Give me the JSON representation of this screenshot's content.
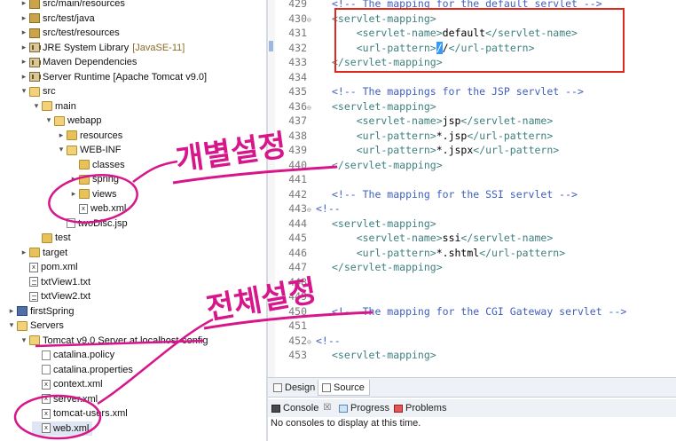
{
  "explorer": {
    "rows": [
      {
        "label": "src/main/resources",
        "indent": 1,
        "twisty": "▸",
        "icon": "pkg",
        "dim": false
      },
      {
        "label": "src/test/java",
        "indent": 1,
        "twisty": "▸",
        "icon": "pkg",
        "dim": false
      },
      {
        "label": "src/test/resources",
        "indent": 1,
        "twisty": "▸",
        "icon": "pkg",
        "dim": false
      },
      {
        "label": "JRE System Library",
        "suffix": "[JavaSE-11]",
        "indent": 1,
        "twisty": "▸",
        "icon": "lib",
        "dim": false
      },
      {
        "label": "Maven Dependencies",
        "indent": 1,
        "twisty": "▸",
        "icon": "lib",
        "dim": false
      },
      {
        "label": "Server Runtime [Apache Tomcat v9.0]",
        "indent": 1,
        "twisty": "▸",
        "icon": "lib",
        "dim": false
      },
      {
        "label": "src",
        "indent": 1,
        "twisty": "▾",
        "icon": "folder-open",
        "dim": false
      },
      {
        "label": "main",
        "indent": 2,
        "twisty": "▾",
        "icon": "folder-open",
        "dim": false
      },
      {
        "label": "webapp",
        "indent": 3,
        "twisty": "▾",
        "icon": "folder-open",
        "dim": false
      },
      {
        "label": "resources",
        "indent": 4,
        "twisty": "▸",
        "icon": "folder",
        "dim": false
      },
      {
        "label": "WEB-INF",
        "indent": 4,
        "twisty": "▾",
        "icon": "folder-open",
        "dim": false
      },
      {
        "label": "classes",
        "indent": 5,
        "twisty": "",
        "icon": "folder",
        "dim": false
      },
      {
        "label": "spring",
        "indent": 5,
        "twisty": "▸",
        "icon": "folder",
        "dim": false
      },
      {
        "label": "views",
        "indent": 5,
        "twisty": "▸",
        "icon": "folder",
        "dim": false
      },
      {
        "label": "web.xml",
        "indent": 5,
        "twisty": "",
        "icon": "xml",
        "dim": false
      },
      {
        "label": "twoDisc.jsp",
        "indent": 4,
        "twisty": "",
        "icon": "jsp",
        "dim": false
      },
      {
        "label": "test",
        "indent": 2,
        "twisty": "",
        "icon": "folder",
        "dim": false
      },
      {
        "label": "target",
        "indent": 1,
        "twisty": "▸",
        "icon": "folder",
        "dim": false
      },
      {
        "label": "pom.xml",
        "indent": 1,
        "twisty": "",
        "icon": "xml",
        "dim": false
      },
      {
        "label": "txtView1.txt",
        "indent": 1,
        "twisty": "",
        "icon": "txt",
        "dim": false
      },
      {
        "label": "txtView2.txt",
        "indent": 1,
        "twisty": "",
        "icon": "txt",
        "dim": false
      },
      {
        "label": "firstSpring",
        "indent": 0,
        "twisty": "▸",
        "icon": "proj",
        "dim": false
      },
      {
        "label": "Servers",
        "indent": 0,
        "twisty": "▾",
        "icon": "folder-open",
        "dim": false
      },
      {
        "label": "Tomcat v9.0 Server at localhost-config",
        "indent": 1,
        "twisty": "▾",
        "icon": "folder-open",
        "dim": false
      },
      {
        "label": "catalina.policy",
        "indent": 2,
        "twisty": "",
        "icon": "file",
        "dim": false
      },
      {
        "label": "catalina.properties",
        "indent": 2,
        "twisty": "",
        "icon": "file",
        "dim": false
      },
      {
        "label": "context.xml",
        "indent": 2,
        "twisty": "",
        "icon": "xml",
        "dim": false
      },
      {
        "label": "server.xml",
        "indent": 2,
        "twisty": "",
        "icon": "xml",
        "dim": false
      },
      {
        "label": "tomcat-users.xml",
        "indent": 2,
        "twisty": "",
        "icon": "xml",
        "dim": false
      },
      {
        "label": "web.xml",
        "indent": 2,
        "twisty": "",
        "icon": "xml",
        "dim": false,
        "selected": true
      }
    ]
  },
  "editor": {
    "lines": [
      {
        "num": "429",
        "fold": "",
        "parts": [
          [
            "cmt",
            "<!-- The mapping for the default servlet -->"
          ]
        ]
      },
      {
        "num": "430",
        "fold": "⊖",
        "parts": [
          [
            "tag",
            "<servlet-mapping>"
          ]
        ]
      },
      {
        "num": "431",
        "fold": "",
        "parts": [
          [
            "sp",
            "    "
          ],
          [
            "tag",
            "<servlet-name>"
          ],
          [
            "txtv",
            "default"
          ],
          [
            "tag",
            "</servlet-name>"
          ]
        ]
      },
      {
        "num": "432",
        "fold": "",
        "parts": [
          [
            "sp",
            "    "
          ],
          [
            "tag",
            "<url-pattern>"
          ],
          [
            "sel",
            "/"
          ],
          [
            "txtv",
            "/"
          ],
          [
            "tag",
            "</url-pattern>"
          ]
        ]
      },
      {
        "num": "433",
        "fold": "",
        "parts": [
          [
            "tag",
            "</servlet-mapping>"
          ]
        ]
      },
      {
        "num": "434",
        "fold": "",
        "parts": []
      },
      {
        "num": "435",
        "fold": "",
        "parts": [
          [
            "cmt",
            "<!-- The mappings for the JSP servlet -->"
          ]
        ]
      },
      {
        "num": "436",
        "fold": "⊖",
        "parts": [
          [
            "tag",
            "<servlet-mapping>"
          ]
        ]
      },
      {
        "num": "437",
        "fold": "",
        "parts": [
          [
            "sp",
            "    "
          ],
          [
            "tag",
            "<servlet-name>"
          ],
          [
            "txtv",
            "jsp"
          ],
          [
            "tag",
            "</servlet-name>"
          ]
        ]
      },
      {
        "num": "438",
        "fold": "",
        "parts": [
          [
            "sp",
            "    "
          ],
          [
            "tag",
            "<url-pattern>"
          ],
          [
            "txtv",
            "*.jsp"
          ],
          [
            "tag",
            "</url-pattern>"
          ]
        ]
      },
      {
        "num": "439",
        "fold": "",
        "parts": [
          [
            "sp",
            "    "
          ],
          [
            "tag",
            "<url-pattern>"
          ],
          [
            "txtv",
            "*.jspx"
          ],
          [
            "tag",
            "</url-pattern>"
          ]
        ]
      },
      {
        "num": "440",
        "fold": "",
        "parts": [
          [
            "tag",
            "</servlet-mapping>"
          ]
        ]
      },
      {
        "num": "441",
        "fold": "",
        "parts": []
      },
      {
        "num": "442",
        "fold": "",
        "parts": [
          [
            "cmt",
            "<!-- The mapping for the SSI servlet -->"
          ]
        ]
      },
      {
        "num": "443",
        "fold": "⊖",
        "parts": [
          [
            "cmt",
            "<!--"
          ]
        ],
        "indent0": true
      },
      {
        "num": "444",
        "fold": "",
        "parts": [
          [
            "tag",
            "<servlet-mapping>"
          ]
        ]
      },
      {
        "num": "445",
        "fold": "",
        "parts": [
          [
            "sp",
            "    "
          ],
          [
            "tag",
            "<servlet-name>"
          ],
          [
            "txtv",
            "ssi"
          ],
          [
            "tag",
            "</servlet-name>"
          ]
        ]
      },
      {
        "num": "446",
        "fold": "",
        "parts": [
          [
            "sp",
            "    "
          ],
          [
            "tag",
            "<url-pattern>"
          ],
          [
            "txtv",
            "*.shtml"
          ],
          [
            "tag",
            "</url-pattern>"
          ]
        ]
      },
      {
        "num": "447",
        "fold": "",
        "parts": [
          [
            "tag",
            "</servlet-mapping>"
          ]
        ]
      },
      {
        "num": "448",
        "fold": "",
        "parts": []
      },
      {
        "num": "449",
        "fold": "",
        "parts": []
      },
      {
        "num": "450",
        "fold": "",
        "parts": [
          [
            "cmt",
            "<!-- The mapping for the CGI Gateway servlet -->"
          ]
        ]
      },
      {
        "num": "451",
        "fold": "",
        "parts": []
      },
      {
        "num": "452",
        "fold": "⊖",
        "parts": [
          [
            "cmt",
            "<!--"
          ]
        ],
        "indent0": true
      },
      {
        "num": "453",
        "fold": "",
        "parts": [
          [
            "tag",
            "<servlet-mapping>"
          ]
        ]
      }
    ]
  },
  "editor_tabs": {
    "design": "Design",
    "source": "Source"
  },
  "console": {
    "tab_console": "Console",
    "tab_console_close": "☒",
    "tab_progress": "Progress",
    "tab_problems": "Problems",
    "message": "No consoles to display at this time."
  },
  "annotations": {
    "note1": "개별설정",
    "note2": "전체설정",
    "ink_color": "#d8168c",
    "box_color": "#e0281e"
  }
}
